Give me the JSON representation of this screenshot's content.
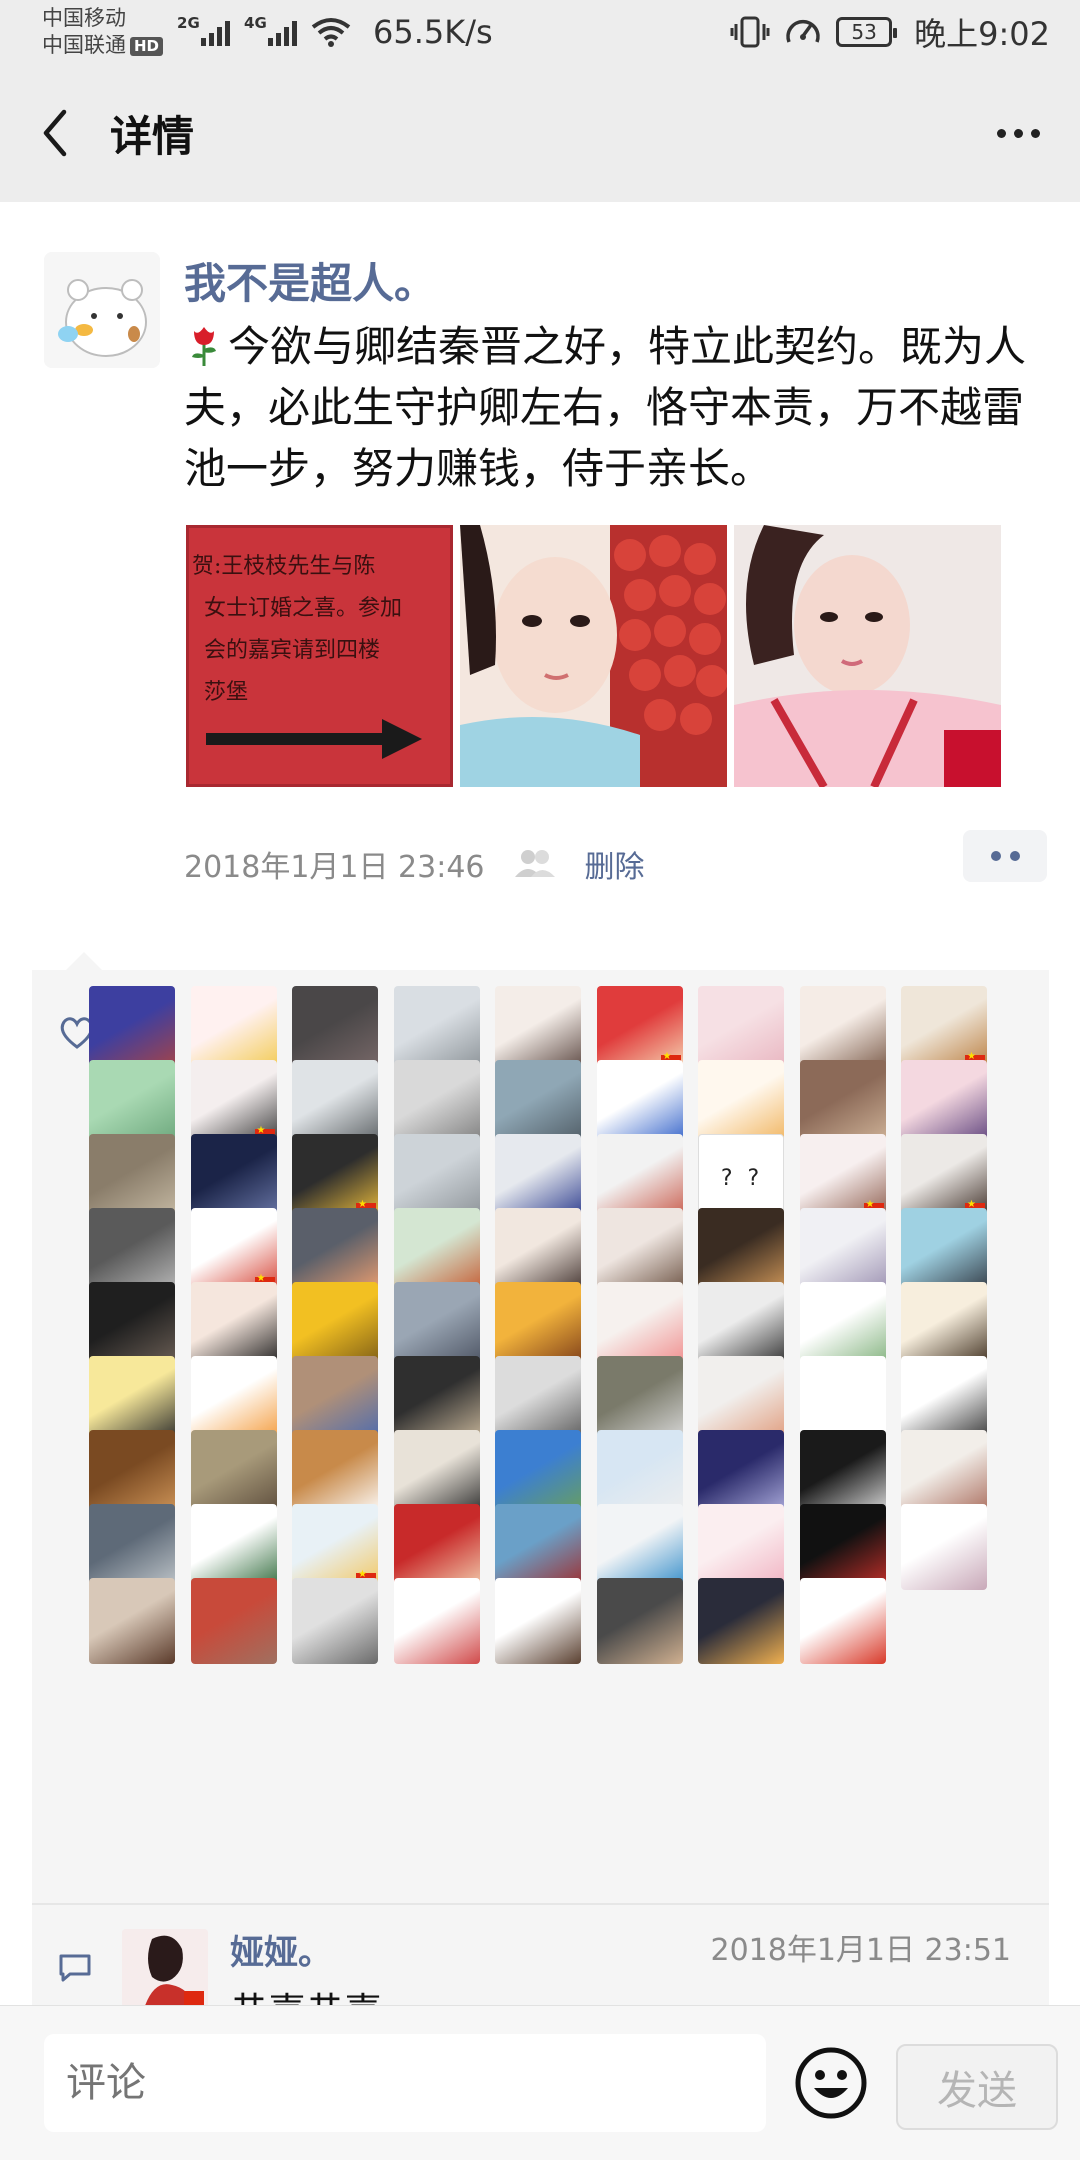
{
  "status_bar": {
    "carrier1": "中国移动",
    "carrier2": "中国联通",
    "hd_badge": "HD",
    "network1": "2G",
    "network2": "4G",
    "speed": "65.5K/s",
    "battery": "53",
    "time": "晚上9:02"
  },
  "nav": {
    "title": "详情"
  },
  "post": {
    "author": "我不是超人。",
    "text": "今欲与卿结秦晋之好，特立此契约。既为人夫，必此生守护卿左右，恪守本责，万不越雷池一步，努力赚钱，侍于亲长。",
    "photos": [
      {
        "sign_lines": [
          "贺:王枝枝先生与陈",
          "女士订婚之喜。参加",
          "会的嘉宾请到四楼",
          "莎堡"
        ]
      },
      {},
      {}
    ],
    "time": "2018年1月1日 23:46",
    "delete_label": "删除"
  },
  "likes": {
    "avatars": [
      {
        "c": "#3d3fa0",
        "c2": "#a44"
      },
      {
        "c": "#fff1f0",
        "c2": "#f2c94c"
      },
      {
        "c": "#4a4748",
        "c2": "#7a6a6a"
      },
      {
        "c": "#d9dee3",
        "c2": "#8a9196"
      },
      {
        "c": "#f4ede8",
        "c2": "#5a4640"
      },
      {
        "c": "#e03c3c",
        "c2": "#f7dbb8"
      },
      {
        "c": "#f6e0e4",
        "c2": "#e8b4bf"
      },
      {
        "c": "#f5ece6",
        "c2": "#7a5a48"
      },
      {
        "c": "#efe6d9",
        "c2": "#b87a3a"
      },
      {
        "c": "#a9d9b3",
        "c2": "#6aa57a"
      },
      {
        "c": "#f4eeee",
        "c2": "#333333"
      },
      {
        "c": "#dfe3e6",
        "c2": "#5a5f62"
      },
      {
        "c": "#d9d9d9",
        "c2": "#7c7c7c"
      },
      {
        "c": "#8fa7b5",
        "c2": "#4e5a63"
      },
      {
        "c": "#ffffff",
        "c2": "#2f5fc8"
      },
      {
        "c": "#fff8ee",
        "c2": "#f0b25a"
      },
      {
        "c": "#8c6a58",
        "c2": "#d1b59a"
      },
      {
        "c": "#f4d8e0",
        "c2": "#5b3f7a"
      },
      {
        "c": "#8a7d6a",
        "c2": "#c7bba5"
      },
      {
        "c": "#1b2448",
        "c2": "#6b78a8"
      },
      {
        "c": "#2d2d2d",
        "c2": "#f3c23c"
      },
      {
        "c": "#cdd3d8",
        "c2": "#8c9297"
      },
      {
        "c": "#e6e9ee",
        "c2": "#2b3a8c"
      },
      {
        "c": "#f2f2f2",
        "c2": "#c85a4a"
      },
      {
        "c": "#ffffff",
        "c2": "#222222",
        "qq": "? ?"
      },
      {
        "c": "#f7efef",
        "c2": "#8b5a4a"
      },
      {
        "c": "#ece9e6",
        "c2": "#3a2a22"
      },
      {
        "c": "#5a5a5a",
        "c2": "#bbbbbb"
      },
      {
        "c": "#ffffff",
        "c2": "#d33b2c"
      },
      {
        "c": "#5a5f6a",
        "c2": "#f0a070"
      },
      {
        "c": "#d4e6d2",
        "c2": "#c4582e"
      },
      {
        "c": "#f1e7df",
        "c2": "#3e2f2b"
      },
      {
        "c": "#eee5e0",
        "c2": "#6a5040"
      },
      {
        "c": "#3a2c22",
        "c2": "#d49a5a"
      },
      {
        "c": "#f0f0f4",
        "c2": "#9a8fb0"
      },
      {
        "c": "#9fd1e2",
        "c2": "#2f3640"
      },
      {
        "c": "#1f1f1f",
        "c2": "#6e6157"
      },
      {
        "c": "#f5e6dd",
        "c2": "#1a1a1a"
      },
      {
        "c": "#f2c022",
        "c2": "#7a5a16"
      },
      {
        "c": "#9aa6b4",
        "c2": "#4a5160"
      },
      {
        "c": "#f2b33c",
        "c2": "#7a3a18"
      },
      {
        "c": "#f6f1ee",
        "c2": "#f08a8a"
      },
      {
        "c": "#ececec",
        "c2": "#2a2a2a"
      },
      {
        "c": "#ffffff",
        "c2": "#7fb07a"
      },
      {
        "c": "#f7eedd",
        "c2": "#3a2a1a"
      },
      {
        "c": "#f7e89a",
        "c2": "#2a2a2a"
      },
      {
        "c": "#ffffff",
        "c2": "#f39a3a"
      },
      {
        "c": "#b09078",
        "c2": "#4a6ab0"
      },
      {
        "c": "#2f2f2f",
        "c2": "#c8b69a"
      },
      {
        "c": "#dcdcdc",
        "c2": "#5a5a5a"
      },
      {
        "c": "#7a7a6a",
        "c2": "#dadada"
      },
      {
        "c": "#f1efed",
        "c2": "#e09a7a"
      },
      {
        "c": "#ffffff",
        "c2": "#ffffff"
      },
      {
        "c": "#ffffff",
        "c2": "#333333"
      },
      {
        "c": "#7a4a22",
        "c2": "#d1975a"
      },
      {
        "c": "#a89a7a",
        "c2": "#5a4a3a"
      },
      {
        "c": "#c88a4a",
        "c2": "#ffffff"
      },
      {
        "c": "#e8e2d8",
        "c2": "#2a2a2a"
      },
      {
        "c": "#3c7fd1",
        "c2": "#6aa05a"
      },
      {
        "c": "#d7e6f3",
        "c2": "#eeeeee"
      },
      {
        "c": "#2a2a6a",
        "c2": "#b0b0e0"
      },
      {
        "c": "#1a1a1a",
        "c2": "#e0e0e0"
      },
      {
        "c": "#f2eee9",
        "c2": "#a86a5a"
      },
      {
        "c": "#5e6a78",
        "c2": "#c2c8cc"
      },
      {
        "c": "#ffffff",
        "c2": "#2f6a3a"
      },
      {
        "c": "#e8f1f6",
        "c2": "#f3c55a"
      },
      {
        "c": "#c82a2a",
        "c2": "#f2d0b0"
      },
      {
        "c": "#6aa0c8",
        "c2": "#a02a2a"
      },
      {
        "c": "#f2f4f6",
        "c2": "#2f8ac8"
      },
      {
        "c": "#fbeef0",
        "c2": "#f0b0c0"
      },
      {
        "c": "#111111",
        "c2": "#c8302a"
      },
      {
        "c": "#ffffff",
        "c2": "#c8a8b8"
      },
      {
        "c": "#d8c8b8",
        "c2": "#5a3a2a"
      },
      {
        "c": "#c84a3a",
        "c2": "#a07060"
      },
      {
        "c": "#e0e0e0",
        "c2": "#6a6a6a"
      },
      {
        "c": "#ffffff",
        "c2": "#d04a4a"
      },
      {
        "c": "#ffffff",
        "c2": "#5a4030"
      },
      {
        "c": "#4a4a4a",
        "c2": "#d0b090"
      },
      {
        "c": "#2a2c3a",
        "c2": "#f0b050"
      },
      {
        "c": "#ffffff",
        "c2": "#d83a2a"
      }
    ]
  },
  "comment": {
    "name": "娅娅。",
    "time": "2018年1月1日 23:51",
    "text": "恭喜恭喜"
  },
  "input": {
    "placeholder": "评论",
    "send_label": "发送"
  }
}
